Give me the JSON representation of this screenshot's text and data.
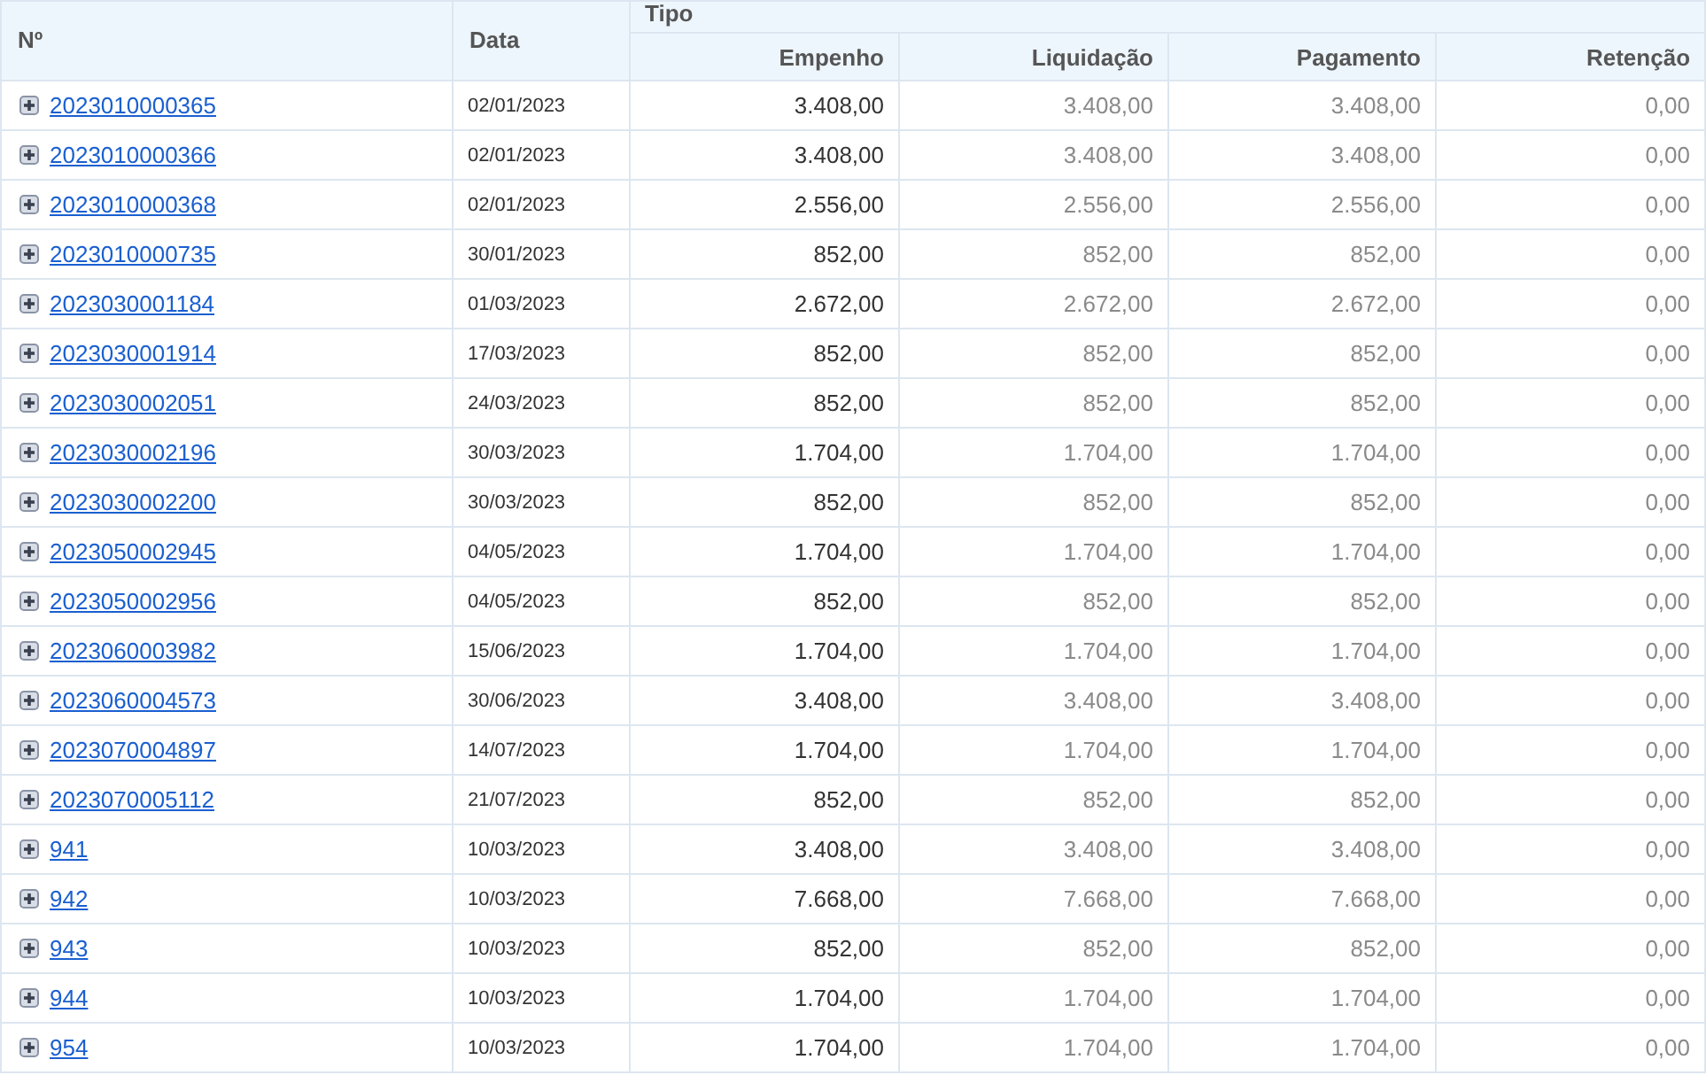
{
  "table": {
    "columns": {
      "number": "Nº",
      "date": "Data",
      "group": "Tipo",
      "values": [
        "Empenho",
        "Liquidação",
        "Pagamento",
        "Retenção"
      ]
    },
    "rows": [
      {
        "number": "2023010000365",
        "expanded": false,
        "date": "02/01/2023",
        "values": [
          "3.408,00",
          "3.408,00",
          "3.408,00",
          "0,00"
        ]
      },
      {
        "number": "2023010000366",
        "expanded": false,
        "date": "02/01/2023",
        "values": [
          "3.408,00",
          "3.408,00",
          "3.408,00",
          "0,00"
        ]
      },
      {
        "number": "2023010000368",
        "expanded": false,
        "date": "02/01/2023",
        "values": [
          "2.556,00",
          "2.556,00",
          "2.556,00",
          "0,00"
        ]
      },
      {
        "number": "2023010000735",
        "expanded": false,
        "date": "30/01/2023",
        "values": [
          "852,00",
          "852,00",
          "852,00",
          "0,00"
        ]
      },
      {
        "number": "2023030001184",
        "expanded": false,
        "date": "01/03/2023",
        "values": [
          "2.672,00",
          "2.672,00",
          "2.672,00",
          "0,00"
        ]
      },
      {
        "number": "2023030001914",
        "expanded": false,
        "date": "17/03/2023",
        "values": [
          "852,00",
          "852,00",
          "852,00",
          "0,00"
        ]
      },
      {
        "number": "2023030002051",
        "expanded": false,
        "date": "24/03/2023",
        "values": [
          "852,00",
          "852,00",
          "852,00",
          "0,00"
        ]
      },
      {
        "number": "2023030002196",
        "expanded": false,
        "date": "30/03/2023",
        "values": [
          "1.704,00",
          "1.704,00",
          "1.704,00",
          "0,00"
        ]
      },
      {
        "number": "2023030002200",
        "expanded": false,
        "date": "30/03/2023",
        "values": [
          "852,00",
          "852,00",
          "852,00",
          "0,00"
        ]
      },
      {
        "number": "2023050002945",
        "expanded": false,
        "date": "04/05/2023",
        "values": [
          "1.704,00",
          "1.704,00",
          "1.704,00",
          "0,00"
        ]
      },
      {
        "number": "2023050002956",
        "expanded": false,
        "date": "04/05/2023",
        "values": [
          "852,00",
          "852,00",
          "852,00",
          "0,00"
        ]
      },
      {
        "number": "2023060003982",
        "expanded": false,
        "date": "15/06/2023",
        "values": [
          "1.704,00",
          "1.704,00",
          "1.704,00",
          "0,00"
        ]
      },
      {
        "number": "2023060004573",
        "expanded": false,
        "date": "30/06/2023",
        "values": [
          "3.408,00",
          "3.408,00",
          "3.408,00",
          "0,00"
        ]
      },
      {
        "number": "2023070004897",
        "expanded": false,
        "date": "14/07/2023",
        "values": [
          "1.704,00",
          "1.704,00",
          "1.704,00",
          "0,00"
        ]
      },
      {
        "number": "2023070005112",
        "expanded": false,
        "date": "21/07/2023",
        "values": [
          "852,00",
          "852,00",
          "852,00",
          "0,00"
        ]
      },
      {
        "number": "941",
        "expanded": false,
        "date": "10/03/2023",
        "values": [
          "3.408,00",
          "3.408,00",
          "3.408,00",
          "0,00"
        ]
      },
      {
        "number": "942",
        "expanded": false,
        "date": "10/03/2023",
        "values": [
          "7.668,00",
          "7.668,00",
          "7.668,00",
          "0,00"
        ]
      },
      {
        "number": "943",
        "expanded": false,
        "date": "10/03/2023",
        "values": [
          "852,00",
          "852,00",
          "852,00",
          "0,00"
        ]
      },
      {
        "number": "944",
        "expanded": false,
        "date": "10/03/2023",
        "values": [
          "1.704,00",
          "1.704,00",
          "1.704,00",
          "0,00"
        ]
      },
      {
        "number": "954",
        "expanded": false,
        "date": "10/03/2023",
        "values": [
          "1.704,00",
          "1.704,00",
          "1.704,00",
          "0,00"
        ]
      }
    ]
  }
}
